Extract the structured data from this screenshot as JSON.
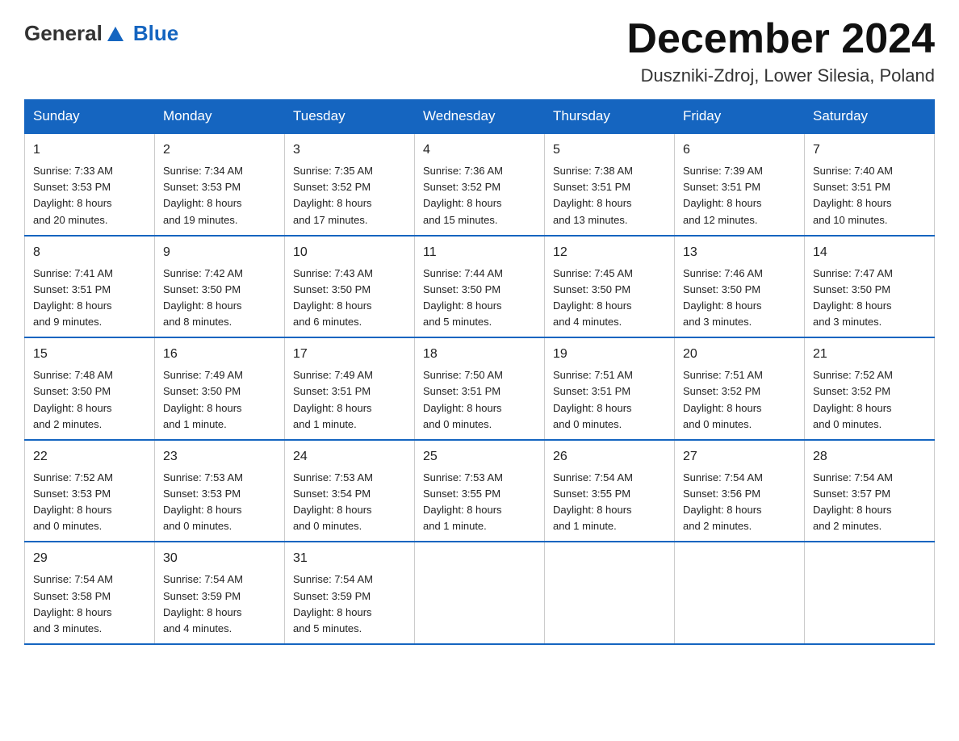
{
  "header": {
    "logo": {
      "general": "General",
      "blue": "Blue"
    },
    "title": "December 2024",
    "location": "Duszniki-Zdroj, Lower Silesia, Poland"
  },
  "days_of_week": [
    "Sunday",
    "Monday",
    "Tuesday",
    "Wednesday",
    "Thursday",
    "Friday",
    "Saturday"
  ],
  "weeks": [
    [
      {
        "day": "1",
        "sunrise": "Sunrise: 7:33 AM",
        "sunset": "Sunset: 3:53 PM",
        "daylight": "Daylight: 8 hours",
        "daylight2": "and 20 minutes."
      },
      {
        "day": "2",
        "sunrise": "Sunrise: 7:34 AM",
        "sunset": "Sunset: 3:53 PM",
        "daylight": "Daylight: 8 hours",
        "daylight2": "and 19 minutes."
      },
      {
        "day": "3",
        "sunrise": "Sunrise: 7:35 AM",
        "sunset": "Sunset: 3:52 PM",
        "daylight": "Daylight: 8 hours",
        "daylight2": "and 17 minutes."
      },
      {
        "day": "4",
        "sunrise": "Sunrise: 7:36 AM",
        "sunset": "Sunset: 3:52 PM",
        "daylight": "Daylight: 8 hours",
        "daylight2": "and 15 minutes."
      },
      {
        "day": "5",
        "sunrise": "Sunrise: 7:38 AM",
        "sunset": "Sunset: 3:51 PM",
        "daylight": "Daylight: 8 hours",
        "daylight2": "and 13 minutes."
      },
      {
        "day": "6",
        "sunrise": "Sunrise: 7:39 AM",
        "sunset": "Sunset: 3:51 PM",
        "daylight": "Daylight: 8 hours",
        "daylight2": "and 12 minutes."
      },
      {
        "day": "7",
        "sunrise": "Sunrise: 7:40 AM",
        "sunset": "Sunset: 3:51 PM",
        "daylight": "Daylight: 8 hours",
        "daylight2": "and 10 minutes."
      }
    ],
    [
      {
        "day": "8",
        "sunrise": "Sunrise: 7:41 AM",
        "sunset": "Sunset: 3:51 PM",
        "daylight": "Daylight: 8 hours",
        "daylight2": "and 9 minutes."
      },
      {
        "day": "9",
        "sunrise": "Sunrise: 7:42 AM",
        "sunset": "Sunset: 3:50 PM",
        "daylight": "Daylight: 8 hours",
        "daylight2": "and 8 minutes."
      },
      {
        "day": "10",
        "sunrise": "Sunrise: 7:43 AM",
        "sunset": "Sunset: 3:50 PM",
        "daylight": "Daylight: 8 hours",
        "daylight2": "and 6 minutes."
      },
      {
        "day": "11",
        "sunrise": "Sunrise: 7:44 AM",
        "sunset": "Sunset: 3:50 PM",
        "daylight": "Daylight: 8 hours",
        "daylight2": "and 5 minutes."
      },
      {
        "day": "12",
        "sunrise": "Sunrise: 7:45 AM",
        "sunset": "Sunset: 3:50 PM",
        "daylight": "Daylight: 8 hours",
        "daylight2": "and 4 minutes."
      },
      {
        "day": "13",
        "sunrise": "Sunrise: 7:46 AM",
        "sunset": "Sunset: 3:50 PM",
        "daylight": "Daylight: 8 hours",
        "daylight2": "and 3 minutes."
      },
      {
        "day": "14",
        "sunrise": "Sunrise: 7:47 AM",
        "sunset": "Sunset: 3:50 PM",
        "daylight": "Daylight: 8 hours",
        "daylight2": "and 3 minutes."
      }
    ],
    [
      {
        "day": "15",
        "sunrise": "Sunrise: 7:48 AM",
        "sunset": "Sunset: 3:50 PM",
        "daylight": "Daylight: 8 hours",
        "daylight2": "and 2 minutes."
      },
      {
        "day": "16",
        "sunrise": "Sunrise: 7:49 AM",
        "sunset": "Sunset: 3:50 PM",
        "daylight": "Daylight: 8 hours",
        "daylight2": "and 1 minute."
      },
      {
        "day": "17",
        "sunrise": "Sunrise: 7:49 AM",
        "sunset": "Sunset: 3:51 PM",
        "daylight": "Daylight: 8 hours",
        "daylight2": "and 1 minute."
      },
      {
        "day": "18",
        "sunrise": "Sunrise: 7:50 AM",
        "sunset": "Sunset: 3:51 PM",
        "daylight": "Daylight: 8 hours",
        "daylight2": "and 0 minutes."
      },
      {
        "day": "19",
        "sunrise": "Sunrise: 7:51 AM",
        "sunset": "Sunset: 3:51 PM",
        "daylight": "Daylight: 8 hours",
        "daylight2": "and 0 minutes."
      },
      {
        "day": "20",
        "sunrise": "Sunrise: 7:51 AM",
        "sunset": "Sunset: 3:52 PM",
        "daylight": "Daylight: 8 hours",
        "daylight2": "and 0 minutes."
      },
      {
        "day": "21",
        "sunrise": "Sunrise: 7:52 AM",
        "sunset": "Sunset: 3:52 PM",
        "daylight": "Daylight: 8 hours",
        "daylight2": "and 0 minutes."
      }
    ],
    [
      {
        "day": "22",
        "sunrise": "Sunrise: 7:52 AM",
        "sunset": "Sunset: 3:53 PM",
        "daylight": "Daylight: 8 hours",
        "daylight2": "and 0 minutes."
      },
      {
        "day": "23",
        "sunrise": "Sunrise: 7:53 AM",
        "sunset": "Sunset: 3:53 PM",
        "daylight": "Daylight: 8 hours",
        "daylight2": "and 0 minutes."
      },
      {
        "day": "24",
        "sunrise": "Sunrise: 7:53 AM",
        "sunset": "Sunset: 3:54 PM",
        "daylight": "Daylight: 8 hours",
        "daylight2": "and 0 minutes."
      },
      {
        "day": "25",
        "sunrise": "Sunrise: 7:53 AM",
        "sunset": "Sunset: 3:55 PM",
        "daylight": "Daylight: 8 hours",
        "daylight2": "and 1 minute."
      },
      {
        "day": "26",
        "sunrise": "Sunrise: 7:54 AM",
        "sunset": "Sunset: 3:55 PM",
        "daylight": "Daylight: 8 hours",
        "daylight2": "and 1 minute."
      },
      {
        "day": "27",
        "sunrise": "Sunrise: 7:54 AM",
        "sunset": "Sunset: 3:56 PM",
        "daylight": "Daylight: 8 hours",
        "daylight2": "and 2 minutes."
      },
      {
        "day": "28",
        "sunrise": "Sunrise: 7:54 AM",
        "sunset": "Sunset: 3:57 PM",
        "daylight": "Daylight: 8 hours",
        "daylight2": "and 2 minutes."
      }
    ],
    [
      {
        "day": "29",
        "sunrise": "Sunrise: 7:54 AM",
        "sunset": "Sunset: 3:58 PM",
        "daylight": "Daylight: 8 hours",
        "daylight2": "and 3 minutes."
      },
      {
        "day": "30",
        "sunrise": "Sunrise: 7:54 AM",
        "sunset": "Sunset: 3:59 PM",
        "daylight": "Daylight: 8 hours",
        "daylight2": "and 4 minutes."
      },
      {
        "day": "31",
        "sunrise": "Sunrise: 7:54 AM",
        "sunset": "Sunset: 3:59 PM",
        "daylight": "Daylight: 8 hours",
        "daylight2": "and 5 minutes."
      },
      null,
      null,
      null,
      null
    ]
  ]
}
